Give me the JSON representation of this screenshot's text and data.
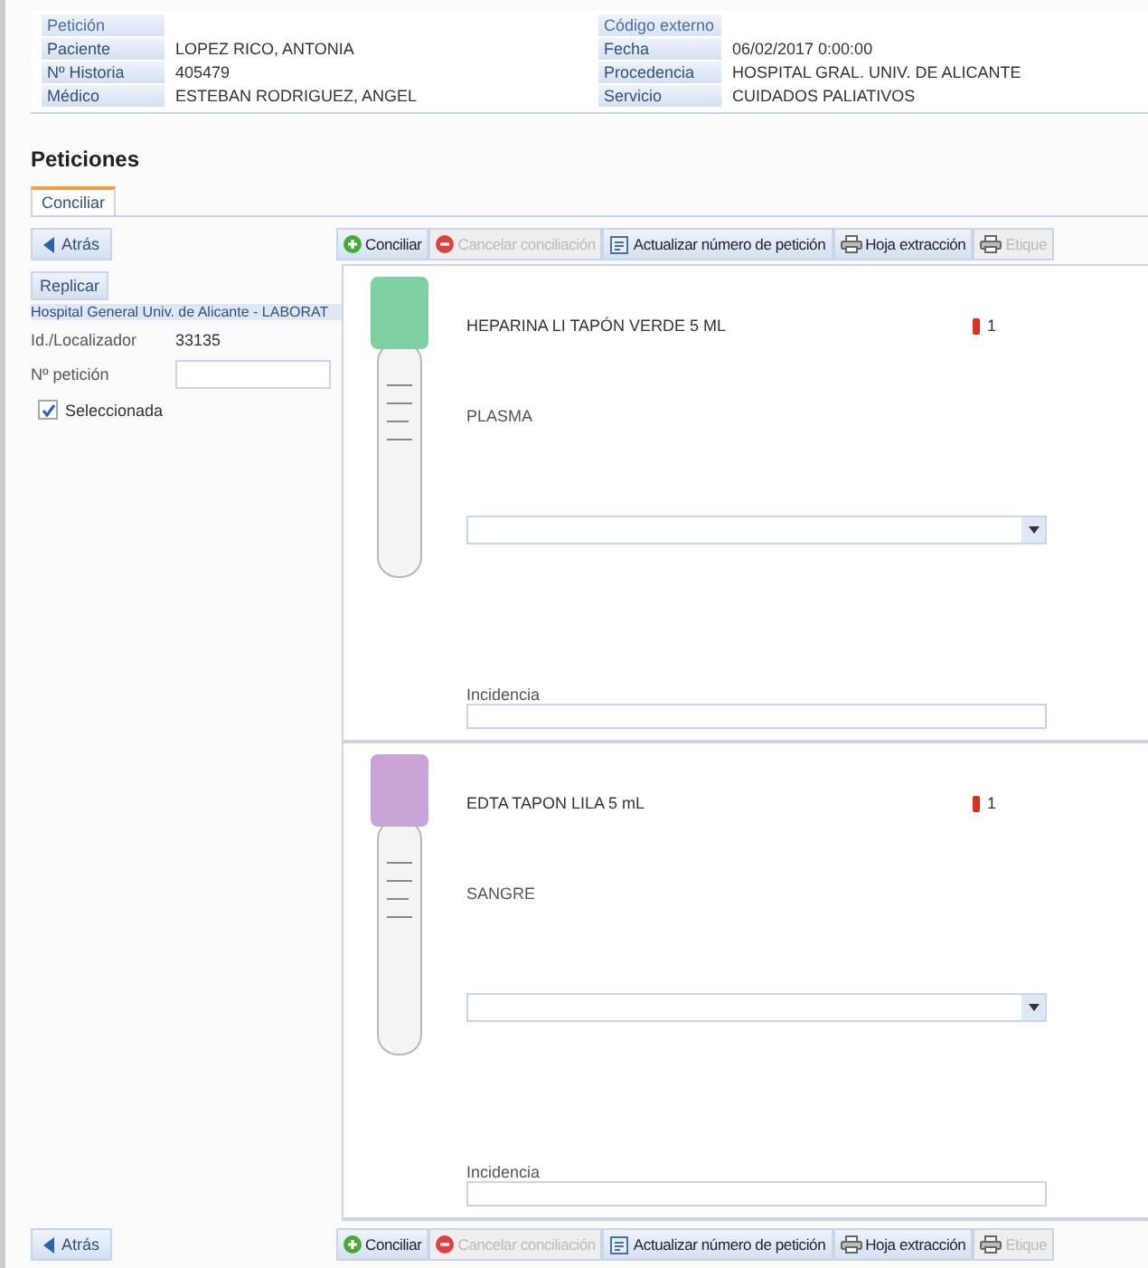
{
  "header": {
    "title": "Petición",
    "right_title": "Código externo",
    "left_rows": [
      {
        "label": "Paciente",
        "value": "LOPEZ RICO, ANTONIA"
      },
      {
        "label": "Nº Historia",
        "value": "405479"
      },
      {
        "label": "Médico",
        "value": "ESTEBAN RODRIGUEZ, ANGEL"
      }
    ],
    "right_rows": [
      {
        "label": "Fecha",
        "value": "06/02/2017 0:00:00"
      },
      {
        "label": "Procedencia",
        "value": "HOSPITAL GRAL. UNIV. DE ALICANTE"
      },
      {
        "label": "Servicio",
        "value": "CUIDADOS PALIATIVOS"
      }
    ]
  },
  "section_title": "Peticiones",
  "tabs": [
    {
      "label": "Conciliar",
      "selected": true
    }
  ],
  "top_toolbar": {
    "back": "Atrás",
    "actions": [
      {
        "kind": "add",
        "label": "Conciliar",
        "disabled": false
      },
      {
        "kind": "cancel",
        "label": "Cancelar conciliación",
        "disabled": true
      },
      {
        "kind": "update",
        "label": "Actualizar número de petición",
        "disabled": false
      },
      {
        "kind": "print",
        "label": "Hoja extracción",
        "disabled": false
      },
      {
        "kind": "print",
        "label": "Etique",
        "disabled": true
      }
    ]
  },
  "left_panel": {
    "replicate": "Replicar",
    "lab": "Hospital General Univ. de Alicante - LABORAT",
    "locator_label": "Id./Localizador",
    "locator_value": "33135",
    "request_label": "Nº petición",
    "selected_label": "Seleccionada",
    "checked": true
  },
  "tubes": [
    {
      "name": "HEPARINA LI TAPÓN VERDE 5 ML",
      "sample": "PLASMA",
      "count": "1",
      "color": "#7fd0a0",
      "incidence_label": "Incidencia"
    },
    {
      "name": "EDTA TAPON LILA 5 mL",
      "sample": "SANGRE",
      "count": "1",
      "color": "#c7a3d6",
      "incidence_label": "Incidencia"
    }
  ],
  "bottom_toolbar": {
    "back": "Atrás",
    "actions": [
      {
        "kind": "add",
        "label": "Conciliar",
        "disabled": false
      },
      {
        "kind": "cancel",
        "label": "Cancelar conciliación",
        "disabled": true
      },
      {
        "kind": "update",
        "label": "Actualizar número de petición",
        "disabled": false
      },
      {
        "kind": "print",
        "label": "Hoja extracción",
        "disabled": false
      },
      {
        "kind": "print",
        "label": "Etique",
        "disabled": true
      }
    ]
  }
}
